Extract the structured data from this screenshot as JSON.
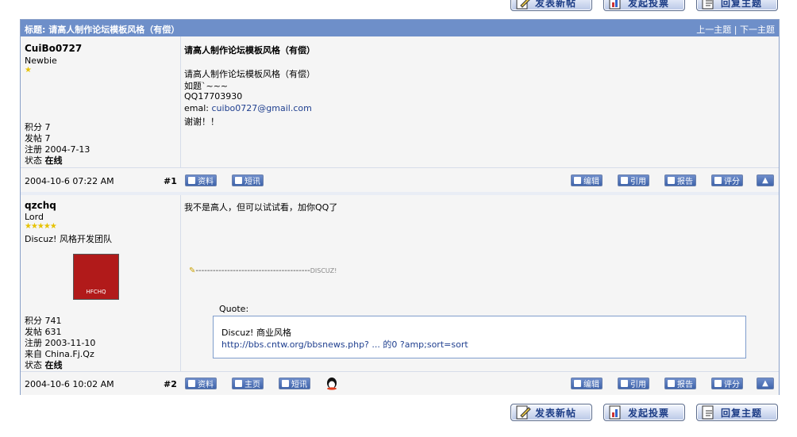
{
  "top_buttons": [
    {
      "label": "发表新帖",
      "icon": "new-post-icon"
    },
    {
      "label": "发起投票",
      "icon": "poll-icon"
    },
    {
      "label": "回复主题",
      "icon": "reply-icon"
    }
  ],
  "bottom_buttons": [
    {
      "label": "发表新帖",
      "icon": "new-post-icon"
    },
    {
      "label": "发起投票",
      "icon": "poll-icon"
    },
    {
      "label": "回复主题",
      "icon": "reply-icon"
    }
  ],
  "thread": {
    "title": "标题: 请高人制作论坛模板风格（有偿）",
    "prev": "上一主题",
    "divider": "|",
    "next": "下一主题"
  },
  "posts": [
    {
      "author": "CuiBo0727",
      "rank": "Newbie",
      "stars": "★",
      "score": "积分 7",
      "post_count": "发帖 7",
      "reg": "注册 2004-7-13",
      "status_label": "状态",
      "status": "在线",
      "subject": "请高人制作论坛模板风格（有偿）",
      "body_line1": "请高人制作论坛模板风格（有偿）",
      "body_line2": "如题`~~~",
      "body_line3": "QQ17703930",
      "email_label": "emal:",
      "email": "cuibo0727@gmail.com",
      "body_line5": "谢谢！！",
      "date": "2004-10-6 07:22 AM",
      "floor": "#1",
      "left_buttons": [
        "资料",
        "短讯"
      ],
      "right_buttons": [
        "编辑",
        "引用",
        "报告",
        "评分"
      ]
    },
    {
      "author": "qzchq",
      "rank": "Lord",
      "stars": "★★★★★",
      "group": "Discuz! 风格开发团队",
      "avatar_text": "HFCHQ",
      "score": "积分 741",
      "post_count": "发帖 631",
      "reg": "注册 2003-11-10",
      "from": "来自 China.Fj.Qz",
      "status_label": "状态",
      "status": "在线",
      "body": "我不是高人，但可以试试看，加你QQ了",
      "sig_dashes": "----------------------------------------",
      "sig_brand": "DISCUZ!",
      "quote_label": "Quote:",
      "quote_line1": "Discuz! 商业风格",
      "quote_link": "http://bbs.cntw.org/bbsnews.php? ... 的0 ?amp;sort=sort",
      "date": "2004-10-6 10:02 AM",
      "floor": "#2",
      "left_buttons": [
        "资料",
        "主页",
        "短讯"
      ],
      "right_buttons": [
        "编辑",
        "引用",
        "报告",
        "评分"
      ]
    }
  ],
  "colors": {
    "header": "#6e8fc9",
    "btn": "#3f64ab",
    "row": "#f5f5f5"
  }
}
